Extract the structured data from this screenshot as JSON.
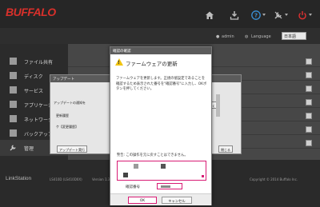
{
  "header": {
    "brand": "BUFFALO",
    "icons": [
      "home-icon",
      "download-icon",
      "help-icon",
      "tools-icon",
      "power-icon"
    ],
    "colors": {
      "brand": "#d9302b",
      "help": "#3a8fd6",
      "power": "#e03030",
      "highlight": "#d81b74"
    }
  },
  "subheader": {
    "user": "admin",
    "language_label": "Language",
    "language_value": "日本語"
  },
  "sidebar": {
    "items": [
      {
        "label": "ファイル共有",
        "icon": "folder-icon"
      },
      {
        "label": "ディスク",
        "icon": "disk-icon"
      },
      {
        "label": "サービス",
        "icon": "service-icon"
      },
      {
        "label": "アプリケーション",
        "icon": "app-icon"
      },
      {
        "label": "ネットワーク",
        "icon": "network-icon"
      },
      {
        "label": "バックアップ",
        "icon": "backup-icon"
      },
      {
        "label": "管理",
        "icon": "wrench-icon"
      }
    ]
  },
  "footer": {
    "product": "LinkStation",
    "model": "LS410D (LS410D0X)",
    "version": "Version 1.3",
    "copyright": "Copyright © 2014 Buffalo Inc."
  },
  "update_dialog": {
    "title": "アップデート",
    "line1": "アップデートの通知を",
    "line2": "更新履歴",
    "line3": "ケ【変更履歴】",
    "settings_button": "設定を開く",
    "update_button": "アップデート実行",
    "close_button": "閉じる"
  },
  "modal": {
    "title": "確認の確認",
    "heading": "ファームウェアの更新",
    "description": "ファームウェアを更新します。正規の値設定であることを確認するため表示された番号を\"確認番号\"に入力し、OKボタンを押してください。",
    "warning": "警告: この操作を元に戻すことはできません。",
    "code_label": "確認番号",
    "ok_label": "OK",
    "cancel_label": "キャンセル"
  }
}
